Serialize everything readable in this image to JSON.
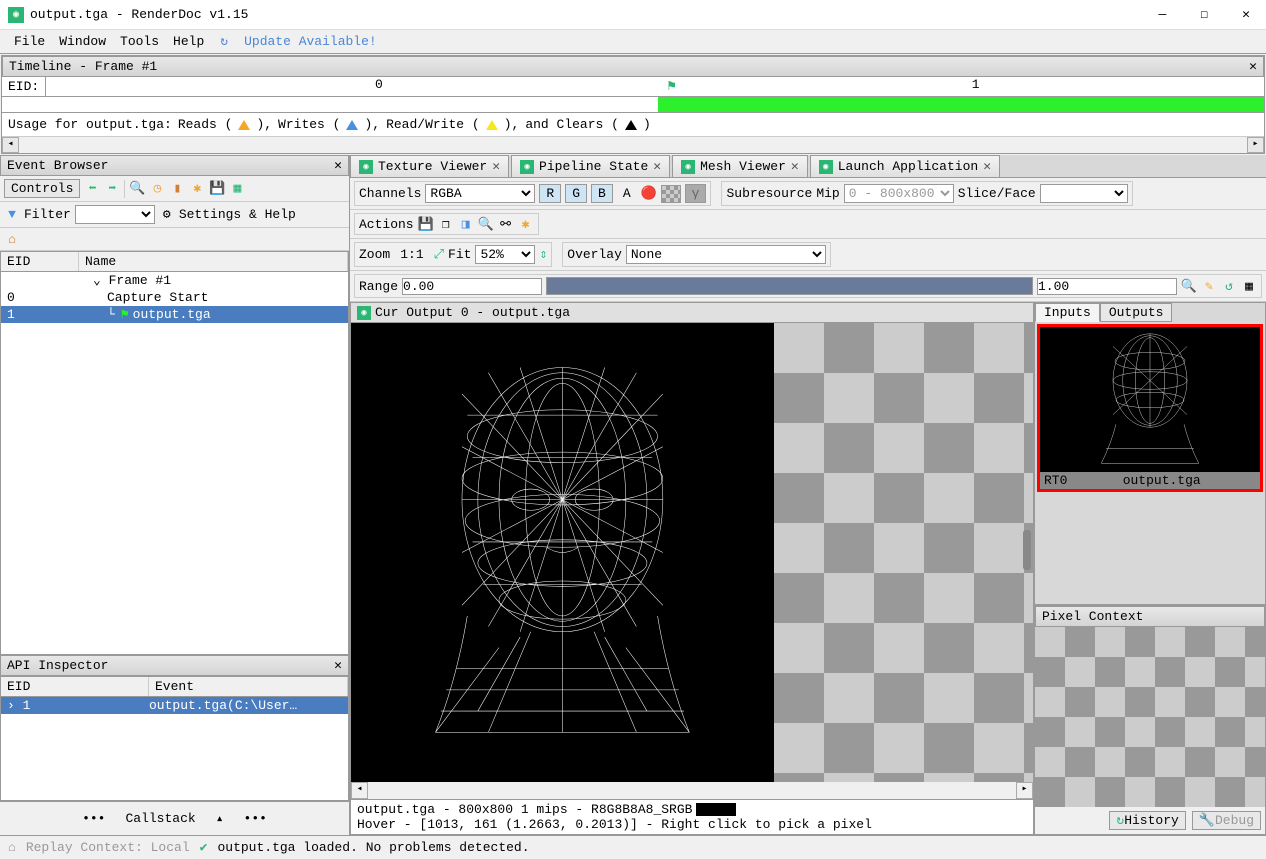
{
  "window": {
    "title": "output.tga - RenderDoc v1.15"
  },
  "menu": {
    "file": "File",
    "window": "Window",
    "tools": "Tools",
    "help": "Help",
    "update": "Update Available!"
  },
  "timeline": {
    "title": "Timeline - Frame #1",
    "eid_label": "EID:",
    "tick0": "0",
    "tick1": "1",
    "usage_prefix": "Usage for output.tga:",
    "reads": "Reads (",
    "writes": "Writes (",
    "readwrite": "Read/Write (",
    "clears": "and Clears (",
    "close_paren": "),",
    "close_paren_last": ")"
  },
  "event_browser": {
    "title": "Event Browser",
    "controls": "Controls",
    "filter_label": "Filter",
    "settings_help": "Settings & Help",
    "col_eid": "EID",
    "col_name": "Name",
    "rows": [
      {
        "eid": "",
        "name": "Frame #1",
        "indent": 1,
        "caret": true
      },
      {
        "eid": "0",
        "name": "Capture Start",
        "indent": 2
      },
      {
        "eid": "1",
        "name": "output.tga",
        "indent": 2,
        "flag": true,
        "selected": true
      }
    ]
  },
  "api_inspector": {
    "title": "API Inspector",
    "col_eid": "EID",
    "col_event": "Event",
    "rows": [
      {
        "eid": "1",
        "event": "output.tga(C:\\User…"
      }
    ],
    "callstack": "Callstack"
  },
  "tabs": {
    "texture_viewer": "Texture Viewer",
    "pipeline_state": "Pipeline State",
    "mesh_viewer": "Mesh Viewer",
    "launch_app": "Launch Application"
  },
  "texture_viewer": {
    "channels_label": "Channels",
    "channels_value": "RGBA",
    "r": "R",
    "g": "G",
    "b": "B",
    "a": "A",
    "gamma": "γ",
    "subresource_label": "Subresource",
    "mip_label": "Mip",
    "mip_value": "0 - 800x800",
    "slice_label": "Slice/Face",
    "actions_label": "Actions",
    "zoom_label": "Zoom",
    "zoom_11": "1:1",
    "fit": "Fit",
    "zoom_pct": "52%",
    "overlay_label": "Overlay",
    "overlay_value": "None",
    "range_label": "Range",
    "range_lo": "0.00",
    "range_hi": "1.00",
    "current_output": "Cur Output 0 - output.tga"
  },
  "io": {
    "inputs": "Inputs",
    "outputs": "Outputs",
    "rt0": "RT0",
    "rt0_name": "output.tga"
  },
  "pixel_context": {
    "title": "Pixel Context",
    "history": "History",
    "debug": "Debug"
  },
  "footer": {
    "line1": "output.tga  -  800x800 1 mips  -  R8G8B8A8_SRGB",
    "line2": "Hover -  [1013,   161 (1.2663,  0.2013)]  -  Right click to pick a pixel"
  },
  "statusbar": {
    "replay": "Replay Context: Local",
    "loaded": "output.tga loaded. No problems detected."
  }
}
